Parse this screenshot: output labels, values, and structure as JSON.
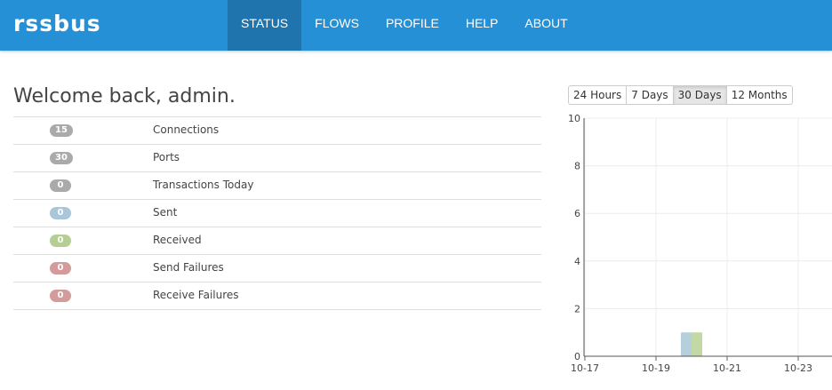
{
  "header": {
    "logo": "rssbus",
    "nav": [
      {
        "label": "STATUS",
        "active": true
      },
      {
        "label": "FLOWS",
        "active": false
      },
      {
        "label": "PROFILE",
        "active": false
      },
      {
        "label": "HELP",
        "active": false
      },
      {
        "label": "ABOUT",
        "active": false
      }
    ],
    "bar_color": "#2590d6",
    "active_color": "#1f74ad"
  },
  "welcome": "Welcome back, admin.",
  "stats": [
    {
      "count": "15",
      "label": "Connections",
      "color": "#aaaaaa"
    },
    {
      "count": "30",
      "label": "Ports",
      "color": "#aaaaaa"
    },
    {
      "count": "0",
      "label": "Transactions Today",
      "color": "#aaaaaa"
    },
    {
      "count": "0",
      "label": "Sent",
      "color": "#a9c7d9"
    },
    {
      "count": "0",
      "label": "Received",
      "color": "#b5ce94"
    },
    {
      "count": "0",
      "label": "Send Failures",
      "color": "#d49b9b"
    },
    {
      "count": "0",
      "label": "Receive Failures",
      "color": "#d49b9b"
    }
  ],
  "range_buttons": [
    {
      "label": "24 Hours",
      "active": false
    },
    {
      "label": "7 Days",
      "active": false
    },
    {
      "label": "30 Days",
      "active": true
    },
    {
      "label": "12 Months",
      "active": false
    }
  ],
  "chart_data": {
    "type": "bar",
    "x": [
      "10-17",
      "10-19",
      "10-21",
      "10-23"
    ],
    "ylim": [
      0,
      10
    ],
    "yticks": [
      0,
      2,
      4,
      6,
      8,
      10
    ],
    "grid": true,
    "series": [
      {
        "color": "#b5d0dc",
        "points": [
          {
            "x": "10-20",
            "y": 1
          }
        ]
      },
      {
        "color": "#c3d8a4",
        "points": [
          {
            "x": "10-20",
            "y": 1
          }
        ]
      }
    ]
  }
}
